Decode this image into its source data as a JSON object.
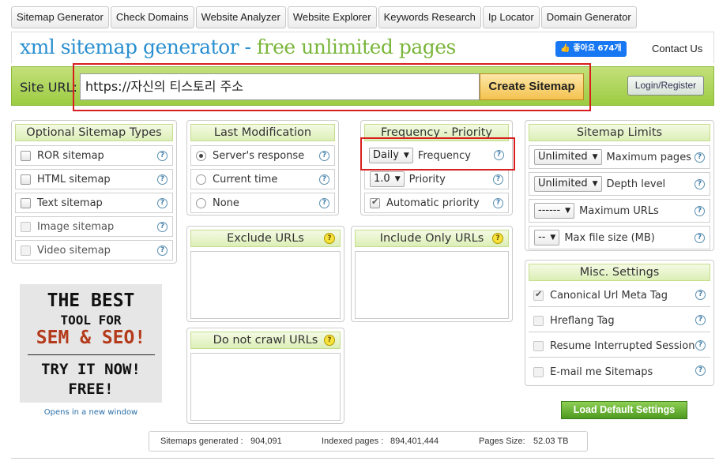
{
  "nav": {
    "tabs": [
      "Sitemap Generator",
      "Check Domains",
      "Website Analyzer",
      "Website Explorer",
      "Keywords Research",
      "Ip Locator",
      "Domain Generator"
    ]
  },
  "header": {
    "title_part1": "xml sitemap generator",
    "title_sep": " - ",
    "title_part2": "free unlimited pages",
    "fb_like": "좋아요 674개",
    "contact": "Contact Us"
  },
  "urlbar": {
    "label": "Site URL:",
    "value": "https://자신의 티스토리 주소",
    "create_button": "Create Sitemap",
    "login_button": "Login/Register"
  },
  "optional_types": {
    "title": "Optional Sitemap Types",
    "items": [
      {
        "label": "ROR sitemap",
        "checked": false,
        "disabled": false
      },
      {
        "label": "HTML sitemap",
        "checked": false,
        "disabled": false
      },
      {
        "label": "Text sitemap",
        "checked": false,
        "disabled": false
      },
      {
        "label": "Image sitemap",
        "checked": false,
        "disabled": true
      },
      {
        "label": "Video sitemap",
        "checked": false,
        "disabled": true
      }
    ]
  },
  "last_mod": {
    "title": "Last Modification",
    "items": [
      {
        "label": "Server's response",
        "selected": true
      },
      {
        "label": "Current time",
        "selected": false
      },
      {
        "label": "None",
        "selected": false
      }
    ]
  },
  "freq": {
    "title": "Frequency - Priority",
    "frequency_value": "Daily",
    "frequency_label": "Frequency",
    "priority_value": "1.0",
    "priority_label": "Priority",
    "auto_label": "Automatic priority"
  },
  "limits": {
    "title": "Sitemap Limits",
    "rows": [
      {
        "value": "Unlimited",
        "label": "Maximum pages"
      },
      {
        "value": "Unlimited",
        "label": "Depth level"
      },
      {
        "value": "------",
        "label": "Maximum URLs"
      },
      {
        "value": "--",
        "label": "Max file size (MB)"
      }
    ]
  },
  "exclude": {
    "title": "Exclude URLs"
  },
  "include": {
    "title": "Include Only URLs"
  },
  "nocrawl": {
    "title": "Do not crawl URLs"
  },
  "misc": {
    "title": "Misc. Settings",
    "items": [
      {
        "label": "Canonical Url Meta Tag",
        "checked": true
      },
      {
        "label": "Hreflang Tag",
        "checked": false
      },
      {
        "label": "Resume Interrupted Session",
        "checked": false
      },
      {
        "label": "E-mail me Sitemaps",
        "checked": false
      }
    ]
  },
  "ad": {
    "line1": "THE BEST",
    "line2": "TOOL FOR",
    "line3": "SEM & SEO!",
    "line4": "TRY IT NOW!",
    "line5": "FREE!",
    "opens": "Opens in a new window"
  },
  "load_button": "Load Default Settings",
  "stats": {
    "generated_label": "Sitemaps generated :",
    "generated_value": "904,091",
    "indexed_label": "Indexed pages :",
    "indexed_value": "894,401,444",
    "size_label": "Pages Size:",
    "size_value": "52.03 TB"
  }
}
